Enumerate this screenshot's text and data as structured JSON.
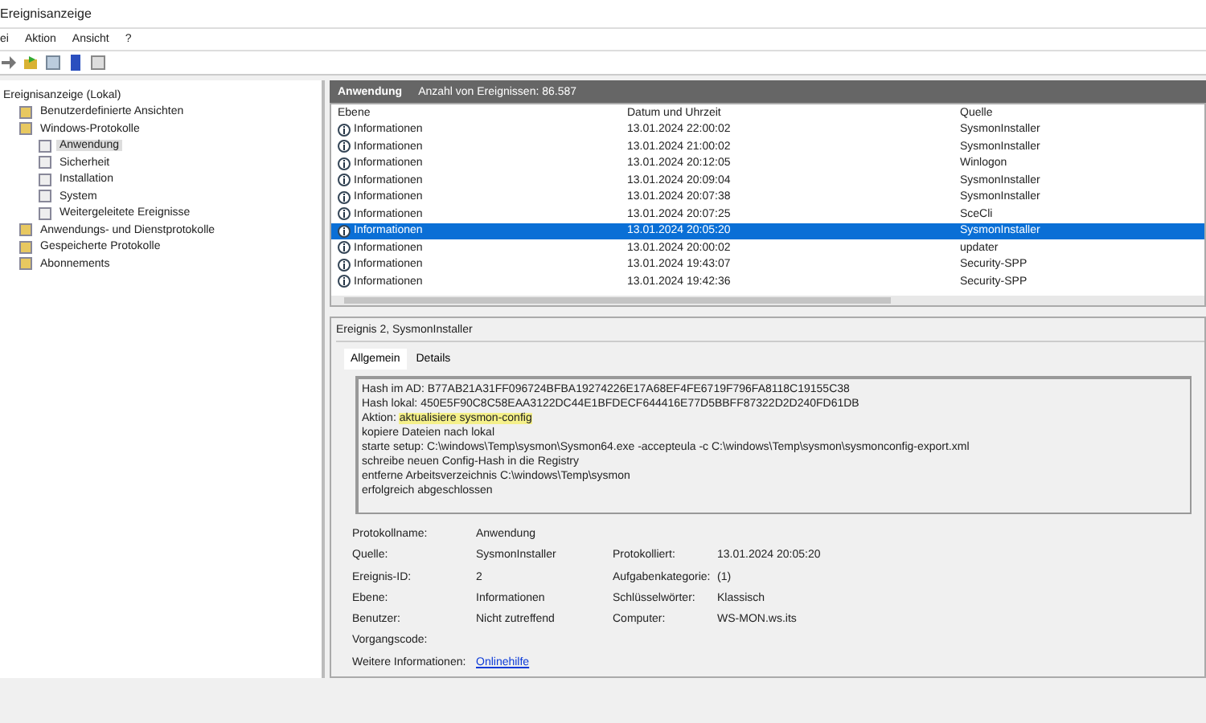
{
  "window": {
    "title": "Ereignisanzeige"
  },
  "menu": [
    {
      "label": "ei"
    },
    {
      "label": "Aktion"
    },
    {
      "label": "Ansicht"
    },
    {
      "label": "?"
    }
  ],
  "tree": [
    {
      "label": "Ereignisanzeige (Lokal)",
      "selected": false,
      "children": [
        {
          "label": "Benutzerdefinierte Ansichten",
          "selected": false
        },
        {
          "label": "Windows-Protokolle",
          "selected": false,
          "children": [
            {
              "label": "Anwendung",
              "selected": true
            },
            {
              "label": "Sicherheit",
              "selected": false
            },
            {
              "label": "Installation",
              "selected": false
            },
            {
              "label": "System",
              "selected": false
            },
            {
              "label": "Weitergeleitete Ereignisse",
              "selected": false
            }
          ]
        },
        {
          "label": "Anwendungs- und Dienstprotokolle",
          "selected": false
        },
        {
          "label": "Gespeicherte Protokolle",
          "selected": false
        },
        {
          "label": "Abonnements",
          "selected": false
        }
      ]
    }
  ],
  "log_header": {
    "title": "Anwendung",
    "count": "Anzahl von Ereignissen: 86.587"
  },
  "table": {
    "columns": [
      "Ebene",
      "Datum und Uhrzeit",
      "Quelle"
    ],
    "rows": [
      {
        "cells": [
          "Informationen",
          "13.01.2024 22:00:02",
          "SysmonInstaller"
        ],
        "selected": false
      },
      {
        "cells": [
          "Informationen",
          "13.01.2024 21:00:02",
          "SysmonInstaller"
        ],
        "selected": false
      },
      {
        "cells": [
          "Informationen",
          "13.01.2024 20:12:05",
          "Winlogon"
        ],
        "selected": false
      },
      {
        "cells": [
          "Informationen",
          "13.01.2024 20:09:04",
          "SysmonInstaller"
        ],
        "selected": false
      },
      {
        "cells": [
          "Informationen",
          "13.01.2024 20:07:38",
          "SysmonInstaller"
        ],
        "selected": false
      },
      {
        "cells": [
          "Informationen",
          "13.01.2024 20:07:25",
          "SceCli"
        ],
        "selected": false
      },
      {
        "cells": [
          "Informationen",
          "13.01.2024 20:05:20",
          "SysmonInstaller"
        ],
        "selected": true
      },
      {
        "cells": [
          "Informationen",
          "13.01.2024 20:00:02",
          "updater"
        ],
        "selected": false
      },
      {
        "cells": [
          "Informationen",
          "13.01.2024 19:43:07",
          "Security-SPP"
        ],
        "selected": false
      },
      {
        "cells": [
          "Informationen",
          "13.01.2024 19:42:36",
          "Security-SPP"
        ],
        "selected": false
      }
    ]
  },
  "detail": {
    "title": "Ereignis 2, SysmonInstaller",
    "tabs": [
      {
        "label": "Allgemein",
        "selected": true
      },
      {
        "label": "Details",
        "selected": false
      }
    ],
    "message": [
      {
        "text": "Hash im AD: B77AB21A31FF096724BFBA19274226E17A68EF4FE6719F796FA8118C19155C38"
      },
      {
        "text": "Hash lokal: 450E5F90C8C58EAA3122DC44E1BFDECF644416E77D5BBFF87322D2D240FD61DB"
      },
      {
        "text": "Aktion: ",
        "highlight": "aktualisiere sysmon-config"
      },
      {
        "text": "kopiere Dateien nach lokal"
      },
      {
        "text": "starte setup: C:\\windows\\Temp\\sysmon\\Sysmon64.exe -accepteula -c C:\\windows\\Temp\\sysmon\\sysmonconfig-export.xml"
      },
      {
        "text": "schreibe neuen Config-Hash in die Registry"
      },
      {
        "text": "entferne Arbeitsverzeichnis C:\\windows\\Temp\\sysmon"
      },
      {
        "text": "erfolgreich abgeschlossen"
      }
    ],
    "fields": [
      [
        {
          "label": "Protokollname:",
          "value": "Anwendung"
        }
      ],
      [
        {
          "label": "Quelle:",
          "value": "SysmonInstaller"
        },
        {
          "label": "Protokolliert:",
          "value": "13.01.2024 20:05:20"
        }
      ],
      [
        {
          "label": "Ereignis-ID:",
          "value": "2"
        },
        {
          "label": "Aufgabenkategorie:",
          "value": "(1)"
        }
      ],
      [
        {
          "label": "Ebene:",
          "value": "Informationen"
        },
        {
          "label": "Schlüsselwörter:",
          "value": "Klassisch"
        }
      ],
      [
        {
          "label": "Benutzer:",
          "value": "Nicht zutreffend"
        },
        {
          "label": "Computer:",
          "value": "WS-MON.ws.its"
        }
      ],
      [
        {
          "label": "Vorgangscode:"
        }
      ],
      [
        {
          "label": "Weitere Informationen:",
          "link": "Onlinehilfe"
        }
      ]
    ]
  }
}
